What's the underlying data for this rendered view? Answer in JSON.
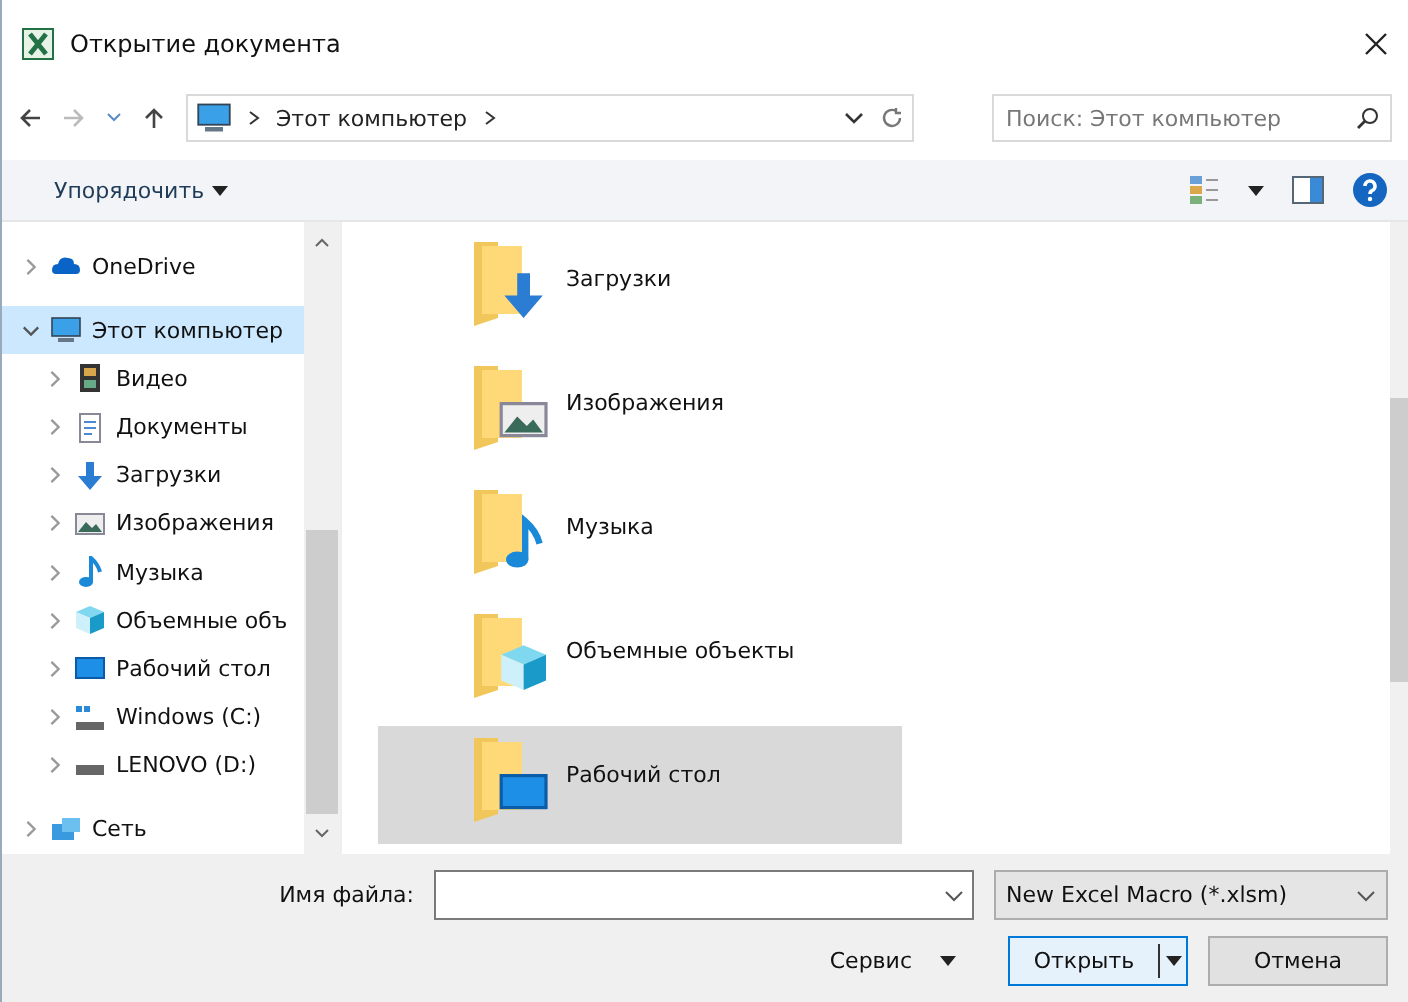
{
  "window": {
    "title": "Открытие документа"
  },
  "address": {
    "path": "Этот компьютер"
  },
  "search": {
    "placeholder": "Поиск: Этот компьютер"
  },
  "toolbar": {
    "organize": "Упорядочить"
  },
  "sidebar": {
    "items": [
      {
        "label": "OneDrive",
        "kind": "cloud",
        "expanded": false,
        "selected": false
      },
      {
        "label": "Этот компьютер",
        "kind": "computer",
        "expanded": true,
        "selected": true,
        "children": [
          {
            "label": "Видео",
            "kind": "video",
            "expanded": false,
            "selected": false
          },
          {
            "label": "Документы",
            "kind": "documents",
            "expanded": false,
            "selected": false
          },
          {
            "label": "Загрузки",
            "kind": "downloads",
            "expanded": false,
            "selected": false
          },
          {
            "label": "Изображения",
            "kind": "pictures",
            "expanded": false,
            "selected": false
          },
          {
            "label": "Музыка",
            "kind": "music",
            "expanded": false,
            "selected": false
          },
          {
            "label": "Объемные объ",
            "kind": "objects3d",
            "expanded": false,
            "selected": false
          },
          {
            "label": "Рабочий стол",
            "kind": "desktop",
            "expanded": false,
            "selected": false
          },
          {
            "label": "Windows (C:)",
            "kind": "systemdrive",
            "expanded": false,
            "selected": false
          },
          {
            "label": "LENOVO (D:)",
            "kind": "drive",
            "expanded": false,
            "selected": false
          }
        ]
      },
      {
        "label": "Сеть",
        "kind": "network",
        "expanded": false,
        "selected": false
      }
    ]
  },
  "folders": [
    {
      "name": "Загрузки",
      "kind": "downloads",
      "selected": false
    },
    {
      "name": "Изображения",
      "kind": "pictures",
      "selected": false
    },
    {
      "name": "Музыка",
      "kind": "music",
      "selected": false
    },
    {
      "name": "Объемные объекты",
      "kind": "objects3d",
      "selected": false
    },
    {
      "name": "Рабочий стол",
      "kind": "desktop",
      "selected": true
    }
  ],
  "footer": {
    "filename_label": "Имя файла:",
    "file_type": "New Excel Macro (*.xlsm)",
    "tools": "Сервис",
    "open": "Открыть",
    "cancel": "Отмена"
  }
}
